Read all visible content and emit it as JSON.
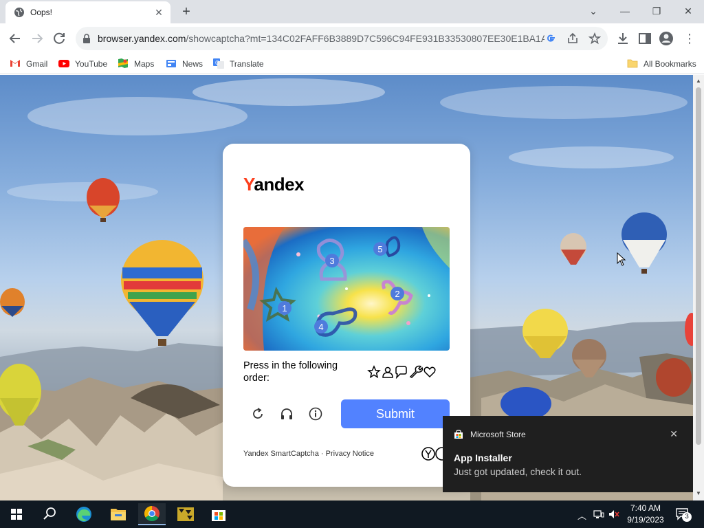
{
  "browser": {
    "tab_title": "Oops!",
    "url_host": "browser.yandex.com",
    "url_rest": "/showcaptcha?mt=134C02FAFF6B3889D7C596C94FE931B33530807EE30E1BA1A4...",
    "bookmarks": [
      {
        "label": "Gmail",
        "icon": "gmail-icon"
      },
      {
        "label": "YouTube",
        "icon": "youtube-icon"
      },
      {
        "label": "Maps",
        "icon": "maps-icon"
      },
      {
        "label": "News",
        "icon": "news-icon"
      },
      {
        "label": "Translate",
        "icon": "translate-icon"
      }
    ],
    "all_bookmarks_label": "All Bookmarks"
  },
  "captcha": {
    "logo_first": "Y",
    "logo_rest": "andex",
    "instruction": "Press in the following order:",
    "order_icons": [
      "star-icon",
      "person-icon",
      "chat-icon",
      "wrench-icon",
      "heart-icon"
    ],
    "puzzle_markers": [
      "1",
      "2",
      "3",
      "4",
      "5"
    ],
    "submit_label": "Submit",
    "footer_brand": "Yandex SmartCaptcha",
    "footer_sep": " · ",
    "footer_link": "Privacy Notice",
    "accent_color": "#5282ff"
  },
  "toast": {
    "app": "Microsoft Store",
    "title": "App Installer",
    "body": "Just got updated, check it out."
  },
  "taskbar": {
    "time": "7:40 AM",
    "date": "9/19/2023",
    "notification_count": "3"
  }
}
